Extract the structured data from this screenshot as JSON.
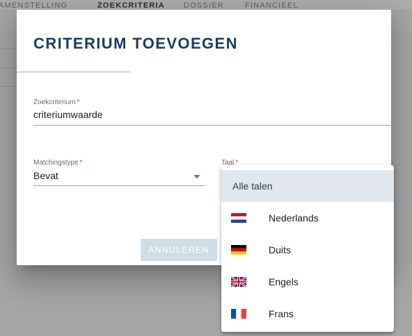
{
  "background": {
    "tabs": [
      "AMENSTELLING",
      "ZOEKCRITERIA",
      "DOSSIER",
      "FINANCIEEL"
    ],
    "active_tab": "ZOEKCRITERIA"
  },
  "dialog": {
    "title": "CRITERIUM TOEVOEGEN",
    "zoekcriterium": {
      "label": "Zoekcriterium",
      "required_marker": "*",
      "value": "criteriumwaarde"
    },
    "matchingstype": {
      "label": "Matchingstype",
      "required_marker": "*",
      "value": "Bevat"
    },
    "taal": {
      "label": "Taal",
      "required_marker": "*"
    },
    "cancel_label": "ANNULEREN"
  },
  "language_dropdown": {
    "options": [
      {
        "label": "Alle talen",
        "flag": "none",
        "selected": true
      },
      {
        "label": "Nederlands",
        "flag": "nl-flag-icon",
        "selected": false
      },
      {
        "label": "Duits",
        "flag": "de-flag-icon",
        "selected": false
      },
      {
        "label": "Engels",
        "flag": "uk-flag-icon",
        "selected": false
      },
      {
        "label": "Frans",
        "flag": "fr-flag-icon",
        "selected": false
      }
    ]
  },
  "colors": {
    "title": "#1d3b63",
    "required": "#e53935",
    "selected_option": "#e2e7ee",
    "cancel_button": "#cfdde6"
  }
}
